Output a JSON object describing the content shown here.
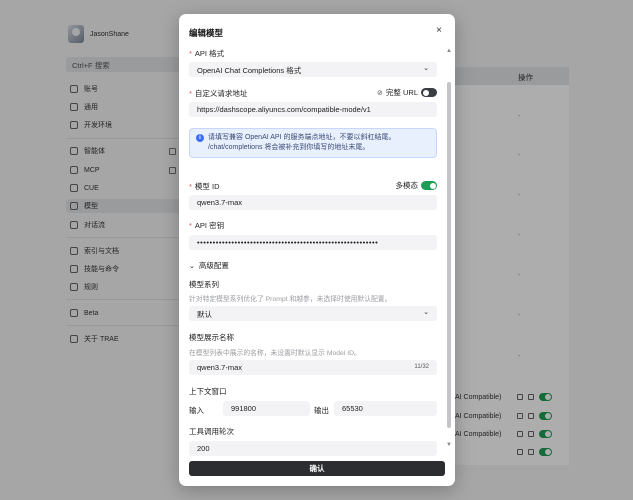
{
  "sidebar": {
    "username": "JasonShane",
    "search_label": "Ctrl+F 搜索",
    "items": [
      {
        "label": "账号",
        "icon": "user-icon"
      },
      {
        "label": "通用",
        "icon": "gear-icon"
      },
      {
        "label": "开发环境",
        "icon": "code-icon"
      },
      {
        "label": "智能体",
        "icon": "bot-icon"
      },
      {
        "label": "MCP",
        "icon": "mcp-icon"
      },
      {
        "label": "CUE",
        "icon": "sparkle-icon"
      },
      {
        "label": "模型",
        "icon": "cube-icon"
      },
      {
        "label": "对话流",
        "icon": "chat-icon"
      },
      {
        "label": "索引与文档",
        "icon": "book-icon"
      },
      {
        "label": "技能与命令",
        "icon": "command-icon"
      },
      {
        "label": "规则",
        "icon": "rules-icon"
      },
      {
        "label": "Beta",
        "icon": "flask-icon"
      },
      {
        "label": "关于 TRAE",
        "icon": "info-icon"
      }
    ]
  },
  "table": {
    "header_actions": "操作",
    "dash": "-",
    "rows_text": [
      "AI Compatible)",
      "AI Compatible)",
      "AI Compatible)"
    ]
  },
  "modal": {
    "title": "编辑模型",
    "close": "×",
    "api_format": {
      "label": "API 格式",
      "value": "OpenAI Chat Completions 格式"
    },
    "request_url": {
      "label": "自定义请求地址",
      "full_url_label": "完整 URL",
      "value": "https://dashscope.aliyuncs.com/compatible-mode/v1"
    },
    "info_text": [
      "请填写兼容 OpenAI API 的服务端点地址，不要以斜杠结尾。",
      "/chat/completions 将会被补充到你填写的地址末尾。"
    ],
    "model_id": {
      "label": "模型 ID",
      "multimodal_label": "多模态",
      "value": "qwen3.7-max"
    },
    "api_key": {
      "label": "API 密钥",
      "value": "••••••••••••••••••••••••••••••••••••••••••••••••••••••••••"
    },
    "advanced_label": "高级配置",
    "model_family": {
      "label": "模型系列",
      "desc": "针对特定模型系列优化了 Prompt 和越参，未选择时使用默认配置。",
      "value": "默认"
    },
    "display_name": {
      "label": "模型展示名称",
      "desc": "在模型列表中展示的名称，未设置时默认显示 Model ID。",
      "value": "qwen3.7-max",
      "counter": "11/32"
    },
    "context_window": {
      "label": "上下文窗口",
      "input_label": "输入",
      "input_value": "991800",
      "output_label": "输出",
      "output_value": "65530"
    },
    "tool_rounds": {
      "label": "工具调用轮次",
      "value": "200"
    },
    "confirm_label": "确认"
  },
  "colors": {
    "accent_green": "#1f9d55",
    "info_blue": "#3b6ff5",
    "confirm_bg": "#2b2d31"
  }
}
